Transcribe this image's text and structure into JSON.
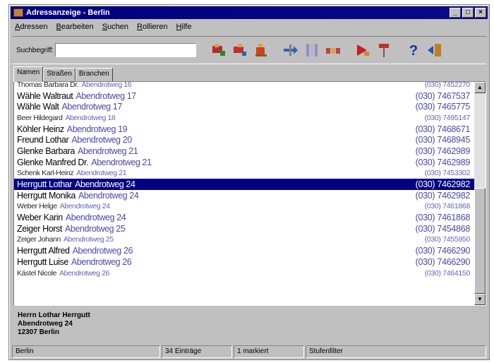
{
  "window": {
    "title": "Adressanzeige - Berlin",
    "minimize": "_",
    "maximize": "□",
    "close": "×"
  },
  "menu": [
    "Adressen",
    "Bearbeiten",
    "Suchen",
    "Rollieren",
    "Hilfe"
  ],
  "search": {
    "label": "Suchbegriff:",
    "value": ""
  },
  "toolbar_icons": [
    "person-list-icon",
    "person-add-icon",
    "person-edit-icon",
    "sort-icon",
    "filter-icon",
    "group-icon",
    "export-icon",
    "pin-icon",
    "help-icon",
    "exit-door-icon"
  ],
  "tabs": [
    "Namen",
    "Straßen",
    "Branchen"
  ],
  "entries": [
    {
      "name": "Thomas Barbara Dr.",
      "street": "Abendrotweg 16",
      "phone": "(030) 7452270",
      "faint": true
    },
    {
      "name": "Wähle Waltraut",
      "street": "Abendrotweg 17",
      "phone": "(030) 7467537"
    },
    {
      "name": "Wähle Walt",
      "street": "Abendrotweg 17",
      "phone": "(030) 7465775"
    },
    {
      "name": "Beer Hildegard",
      "street": "Abendrotweg 18",
      "phone": "(030) 7495147",
      "faint": true
    },
    {
      "name": "Köhler Heinz",
      "street": "Abendrotweg 19",
      "phone": "(030) 7468671"
    },
    {
      "name": "Freund Lothar",
      "street": "Abendrotweg 20",
      "phone": "(030) 7468945"
    },
    {
      "name": "Glenke Barbara",
      "street": "Abendrotweg 21",
      "phone": "(030) 7462989"
    },
    {
      "name": "Glenke Manfred Dr.",
      "street": "Abendrotweg 21",
      "phone": "(030) 7462989"
    },
    {
      "name": "Schenk Karl-Heinz",
      "street": "Abendrotweg 21",
      "phone": "(030) 7453302",
      "faint": true
    },
    {
      "name": "Herrgutt Lothar",
      "street": "Abendrotweg 24",
      "phone": "(030) 7462982",
      "selected": true
    },
    {
      "name": "Herrgutt Monika",
      "street": "Abendrotweg 24",
      "phone": "(030) 7462982"
    },
    {
      "name": "Weber Helge",
      "street": "Abendrotweg 24",
      "phone": "(030) 7461868",
      "faint": true
    },
    {
      "name": "Weber Karin",
      "street": "Abendrotweg 24",
      "phone": "(030) 7461868"
    },
    {
      "name": "Zeiger Horst",
      "street": "Abendrotweg 25",
      "phone": "(030) 7454868"
    },
    {
      "name": "Zeiger Johann",
      "street": "Abendrotweg 25",
      "phone": "(030) 7455950",
      "faint": true
    },
    {
      "name": "Herrgutt Alfred",
      "street": "Abendrotweg 26",
      "phone": "(030) 7466290"
    },
    {
      "name": "Herrgutt Luise",
      "street": "Abendrotweg 26",
      "phone": "(030) 7466290"
    },
    {
      "name": "Kästel Nicole",
      "street": "Abendrotweg 26",
      "phone": "(030) 7464150",
      "faint": true
    }
  ],
  "detail": {
    "line1": "Herrn Lothar Herrgutt",
    "line2": "Abendrotweg 24",
    "line3": "12307 Berlin"
  },
  "status": {
    "city": "Berlin",
    "count": "34 Einträge",
    "marked": "1 markiert",
    "mode": "Stufenfilter"
  }
}
